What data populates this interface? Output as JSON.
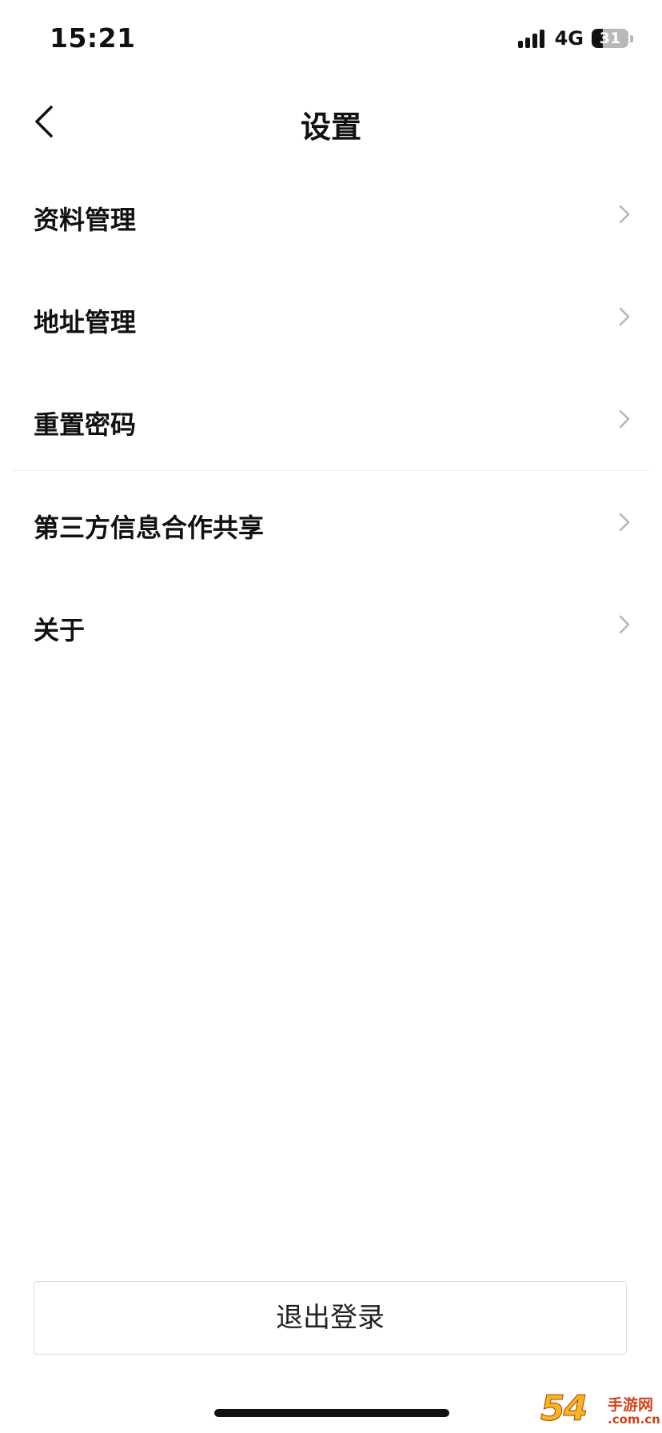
{
  "status_bar": {
    "time": "15:21",
    "network": "4G",
    "battery_level": "31",
    "battery_fraction": 0.31,
    "signal_icon": "signal-bars-icon",
    "battery_icon": "battery-icon"
  },
  "header": {
    "back_icon": "chevron-left-icon",
    "title": "设置"
  },
  "menu": {
    "items": [
      {
        "label": "资料管理",
        "icon": "chevron-right-icon"
      },
      {
        "label": "地址管理",
        "icon": "chevron-right-icon"
      },
      {
        "label": "重置密码",
        "icon": "chevron-right-icon"
      },
      {
        "label": "第三方信息合作共享",
        "icon": "chevron-right-icon"
      },
      {
        "label": "关于",
        "icon": "chevron-right-icon"
      }
    ]
  },
  "logout": {
    "label": "退出登录"
  },
  "watermark": {
    "logo_text": "54",
    "text": "手游网",
    "domain": ".com.cn"
  },
  "colors": {
    "background": "#ffffff",
    "text": "#111111",
    "chevron": "#b5b5b5",
    "divider": "#ededed",
    "button_border": "#dcdcdc"
  }
}
